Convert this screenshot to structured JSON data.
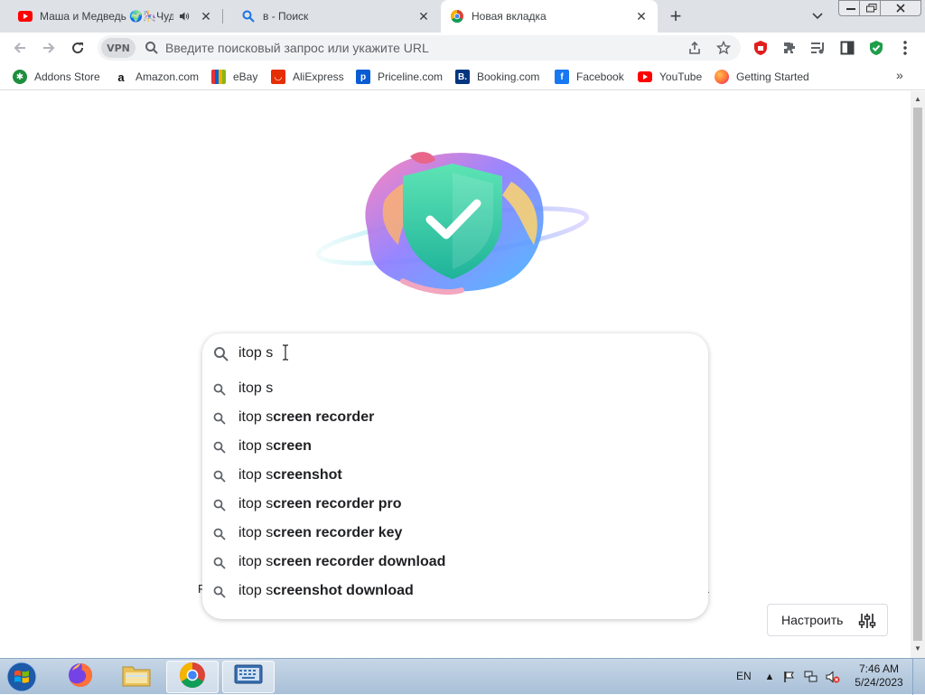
{
  "tabs": [
    {
      "title": "Маша и Медведь 🌍🎠Чудо",
      "favicon": "youtube-icon",
      "audio": true
    },
    {
      "title": "в - Поиск",
      "favicon": "search-icon"
    },
    {
      "title": "Новая вкладка",
      "favicon": "chrome-icon",
      "active": true
    }
  ],
  "toolbar": {
    "vpn_label": "VPN",
    "omnibox_placeholder": "Введите поисковый запрос или укажите URL"
  },
  "bookmarks": [
    {
      "label": "Addons Store",
      "icon": "addons-store-icon",
      "color": "#1e8e3e"
    },
    {
      "label": "Amazon.com",
      "icon": "amazon-icon",
      "color": "#232f3e"
    },
    {
      "label": "eBay",
      "icon": "ebay-icon",
      "color": "#e53238"
    },
    {
      "label": "AliExpress",
      "icon": "aliexpress-icon",
      "color": "#e62e04"
    },
    {
      "label": "Priceline.com",
      "icon": "priceline-icon",
      "color": "#0a5cd5"
    },
    {
      "label": "Booking.com",
      "icon": "booking-icon",
      "color": "#003580"
    },
    {
      "label": "Facebook",
      "icon": "facebook-icon",
      "color": "#1877f2"
    },
    {
      "label": "YouTube",
      "icon": "youtube-icon",
      "color": "#ff0000"
    },
    {
      "label": "Getting Started",
      "icon": "firefox-icon",
      "color": "#ff7139"
    }
  ],
  "search": {
    "query": "itop s",
    "suggestions": [
      {
        "prefix": "itop s",
        "rest": ""
      },
      {
        "prefix": "itop s",
        "rest": "creen recorder"
      },
      {
        "prefix": "itop s",
        "rest": "creen"
      },
      {
        "prefix": "itop s",
        "rest": "creenshot"
      },
      {
        "prefix": "itop s",
        "rest": "creen recorder pro"
      },
      {
        "prefix": "itop s",
        "rest": "creen recorder key"
      },
      {
        "prefix": "itop s",
        "rest": "creen recorder download"
      },
      {
        "prefix": "itop s",
        "rest": "creenshot download"
      }
    ]
  },
  "page": {
    "stray_left": "F",
    "customize_label": "Настроить"
  },
  "taskbar": {
    "language": "EN",
    "time": "7:46 AM",
    "date": "5/24/2023"
  },
  "colors": {
    "tabstrip": "#dee1e6",
    "omnibox": "#f1f3f4",
    "accent": "#1a73e8"
  }
}
